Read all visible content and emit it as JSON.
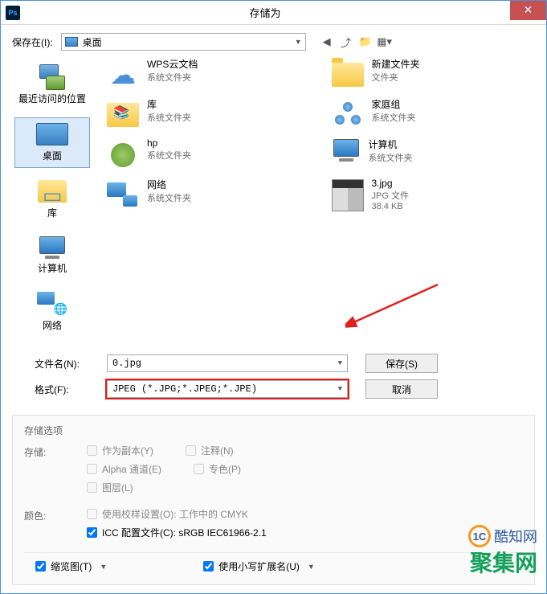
{
  "titlebar": {
    "title": "存储为"
  },
  "toolbar": {
    "save_in_label": "保存在(I):",
    "location": "桌面"
  },
  "sidebar": {
    "items": [
      {
        "label": "最近访问的位置"
      },
      {
        "label": "桌面"
      },
      {
        "label": "库"
      },
      {
        "label": "计算机"
      },
      {
        "label": "网络"
      }
    ]
  },
  "content": {
    "items": [
      {
        "title": "WPS云文档",
        "subtitle": "系统文件夹"
      },
      {
        "title": "新建文件夹",
        "subtitle": "文件夹"
      },
      {
        "title": "库",
        "subtitle": "系统文件夹"
      },
      {
        "title": "家庭组",
        "subtitle": "系统文件夹"
      },
      {
        "title": "hp",
        "subtitle": "系统文件夹"
      },
      {
        "title": "计算机",
        "subtitle": "系统文件夹"
      },
      {
        "title": "网络",
        "subtitle": "系统文件夹"
      },
      {
        "title": "3.jpg",
        "subtitle": "JPG 文件",
        "subtitle2": "38.4 KB"
      }
    ]
  },
  "fields": {
    "filename_label": "文件名(N):",
    "filename_value": "0.jpg",
    "format_label": "格式(F):",
    "format_value": "JPEG (*.JPG;*.JPEG;*.JPE)",
    "save_btn": "保存(S)",
    "cancel_btn": "取消"
  },
  "options": {
    "header": "存储选项",
    "save_label": "存储:",
    "as_copy": "作为副本(Y)",
    "notes": "注释(N)",
    "alpha": "Alpha 通道(E)",
    "spot": "专色(P)",
    "layers": "图层(L)",
    "color_label": "颜色:",
    "proof": "使用校样设置(O): 工作中的 CMYK",
    "icc": "ICC 配置文件(C): sRGB IEC61966-2.1",
    "thumbnail": "缩览图(T)",
    "lowercase": "使用小写扩展名(U)"
  },
  "watermarks": {
    "w1": "酷知网",
    "w2": "聚集网"
  }
}
